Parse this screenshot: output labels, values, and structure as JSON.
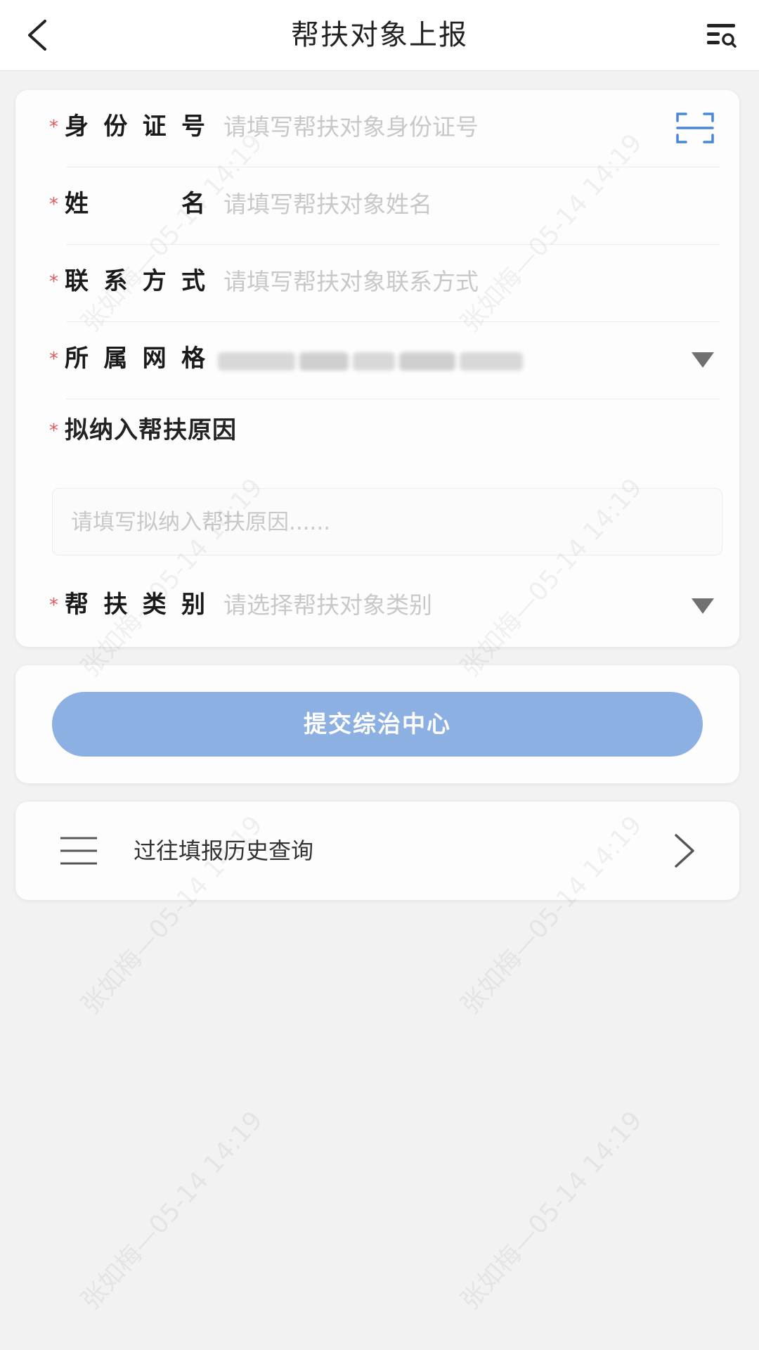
{
  "header": {
    "title": "帮扶对象上报",
    "back_icon": "chevron-left-icon",
    "right_icon": "menu-search-icon"
  },
  "form": {
    "required_mark": "*",
    "id_number": {
      "label_chars": [
        "身",
        "份",
        "证",
        "号"
      ],
      "placeholder": "请填写帮扶对象身份证号",
      "icon": "scan-icon"
    },
    "name": {
      "label_chars": [
        "姓",
        "名"
      ],
      "placeholder": "请填写帮扶对象姓名"
    },
    "contact": {
      "label_chars": [
        "联",
        "系",
        "方",
        "式"
      ],
      "placeholder": "请填写帮扶对象联系方式"
    },
    "grid": {
      "label_chars": [
        "所",
        "属",
        "网",
        "格"
      ],
      "value_redacted": true,
      "icon": "triangle-down-icon"
    },
    "reason": {
      "label": "拟纳入帮扶原因",
      "placeholder": "请填写拟纳入帮扶原因......"
    },
    "category": {
      "label_chars": [
        "帮",
        "扶",
        "类",
        "别"
      ],
      "placeholder": "请选择帮扶对象类别",
      "icon": "triangle-down-icon"
    }
  },
  "submit": {
    "label": "提交综治中心",
    "color": "#8db0e2"
  },
  "history": {
    "label": "过往填报历史查询",
    "icon": "list-icon",
    "arrow_icon": "chevron-right-icon"
  },
  "watermark": {
    "text": "张如梅—05-14 14:19"
  },
  "colors": {
    "required": "#e25a5a",
    "placeholder": "#c8c8c8",
    "accent": "#4a86d8"
  }
}
